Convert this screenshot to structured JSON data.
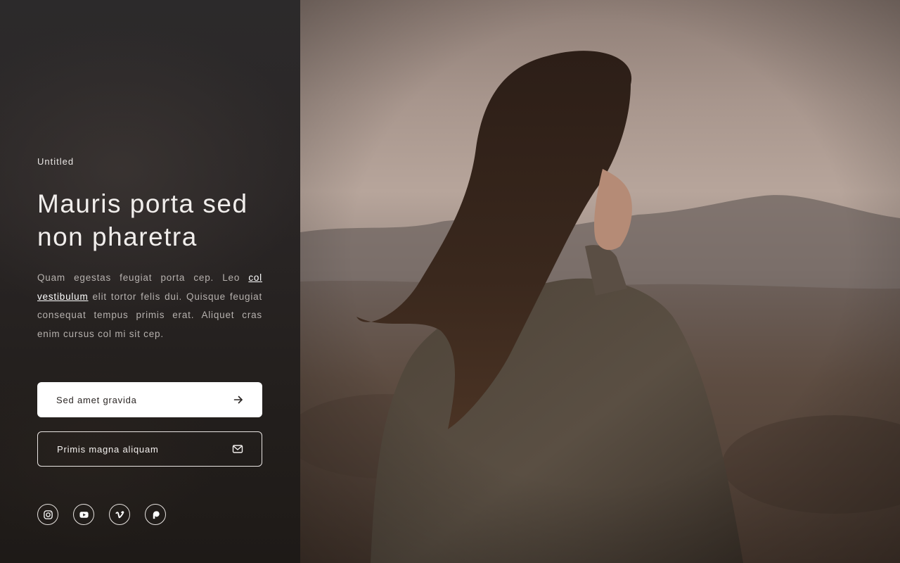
{
  "hero": {
    "eyebrow": "Untitled",
    "title_line1": "Mauris porta sed",
    "title_line2": "non pharetra",
    "description_before_link": "Quam egestas feugiat porta cep. Leo ",
    "description_link": "col vestibulum",
    "description_after_link": " elit tortor felis dui. Quisque feugiat consequat tempus primis erat. Aliquet cras enim cursus col mi sit cep."
  },
  "buttons": {
    "primary_label": "Sed amet gravida",
    "primary_icon": "arrow-right-icon",
    "secondary_label": "Primis magna aliquam",
    "secondary_icon": "envelope-icon"
  },
  "socials": [
    {
      "icon": "instagram-icon"
    },
    {
      "icon": "youtube-icon"
    },
    {
      "icon": "vimeo-icon"
    },
    {
      "icon": "patreon-icon"
    }
  ],
  "colors": {
    "panel_background": "#2a2626",
    "primary_button_background": "#ffffff",
    "text_light": "#f1eeec",
    "text_muted": "#b6b1ae"
  },
  "photo": {
    "subject": "woman-with-long-hair-in-desert-landscape"
  }
}
